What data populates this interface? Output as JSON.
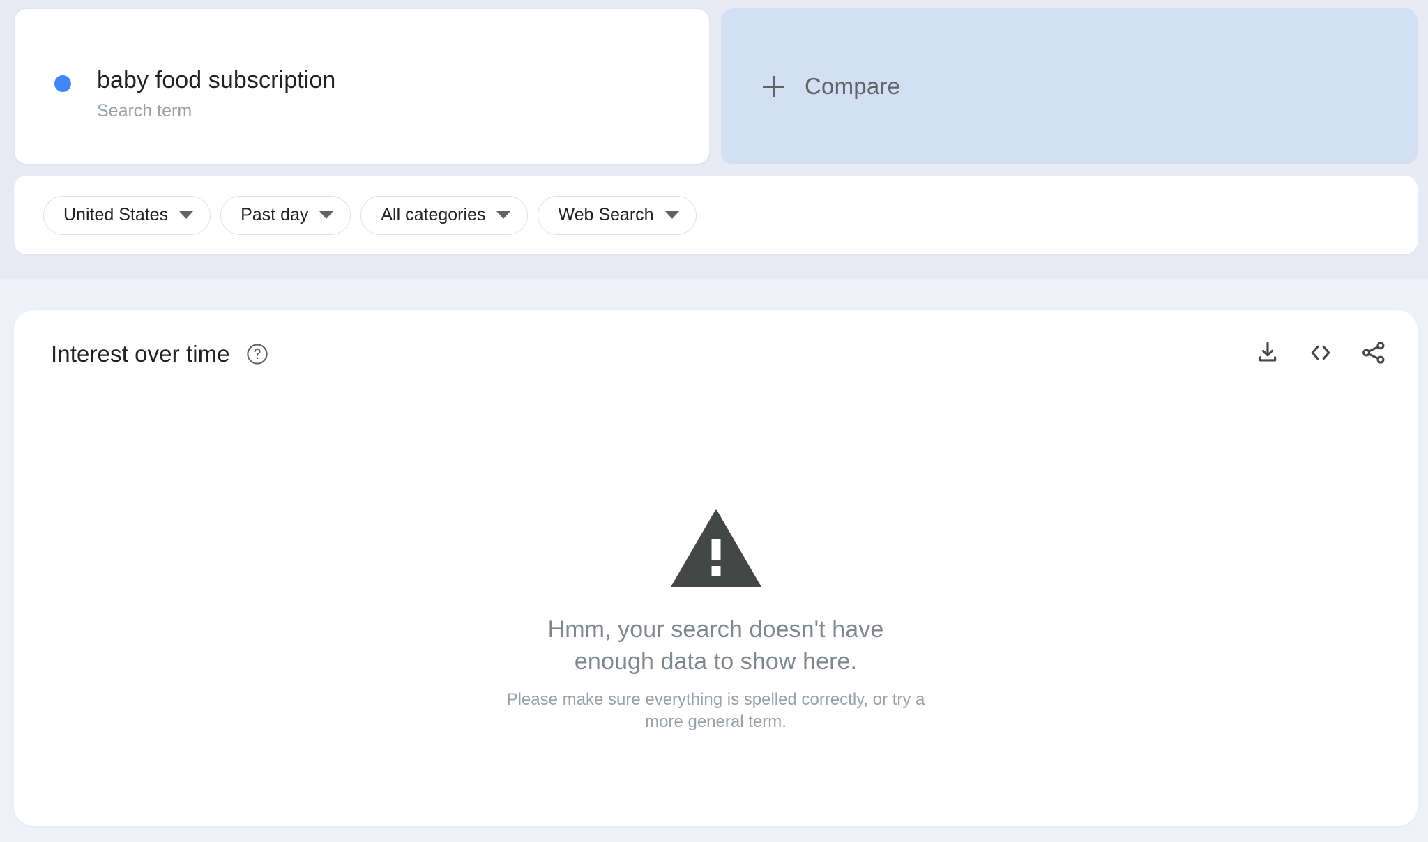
{
  "colors": {
    "page_background": "#eef1f8",
    "top_band_background": "#e8ebf5",
    "card_background": "#ffffff",
    "compare_background": "#d3dff3",
    "series_dot": "#4285f4",
    "primary_text": "#202124",
    "secondary_text": "#5f6368",
    "muted_text": "#9aa0a6",
    "warning_icon": "#444746"
  },
  "term_card": {
    "dot_icon": "series-color-dot",
    "title": "baby food subscription",
    "subtitle": "Search term"
  },
  "compare_card": {
    "plus_icon": "plus-icon",
    "label": "Compare"
  },
  "filters": {
    "chips": [
      {
        "label": "United States",
        "caret_icon": "chevron-down-icon",
        "name": "location-filter"
      },
      {
        "label": "Past day",
        "caret_icon": "chevron-down-icon",
        "name": "time-range-filter"
      },
      {
        "label": "All categories",
        "caret_icon": "chevron-down-icon",
        "name": "category-filter"
      },
      {
        "label": "Web Search",
        "caret_icon": "chevron-down-icon",
        "name": "search-type-filter"
      }
    ]
  },
  "interest_over_time": {
    "title": "Interest over time",
    "help_icon": "help-circle-icon",
    "actions": [
      {
        "name": "download-csv-button",
        "icon": "download-icon"
      },
      {
        "name": "embed-code-button",
        "icon": "code-brackets-icon"
      },
      {
        "name": "share-button",
        "icon": "share-icon"
      }
    ],
    "empty_state": {
      "icon": "warning-triangle-icon",
      "title": "Hmm, your search doesn't have enough data to show here.",
      "subtitle": "Please make sure everything is spelled correctly, or try a more general term."
    }
  }
}
